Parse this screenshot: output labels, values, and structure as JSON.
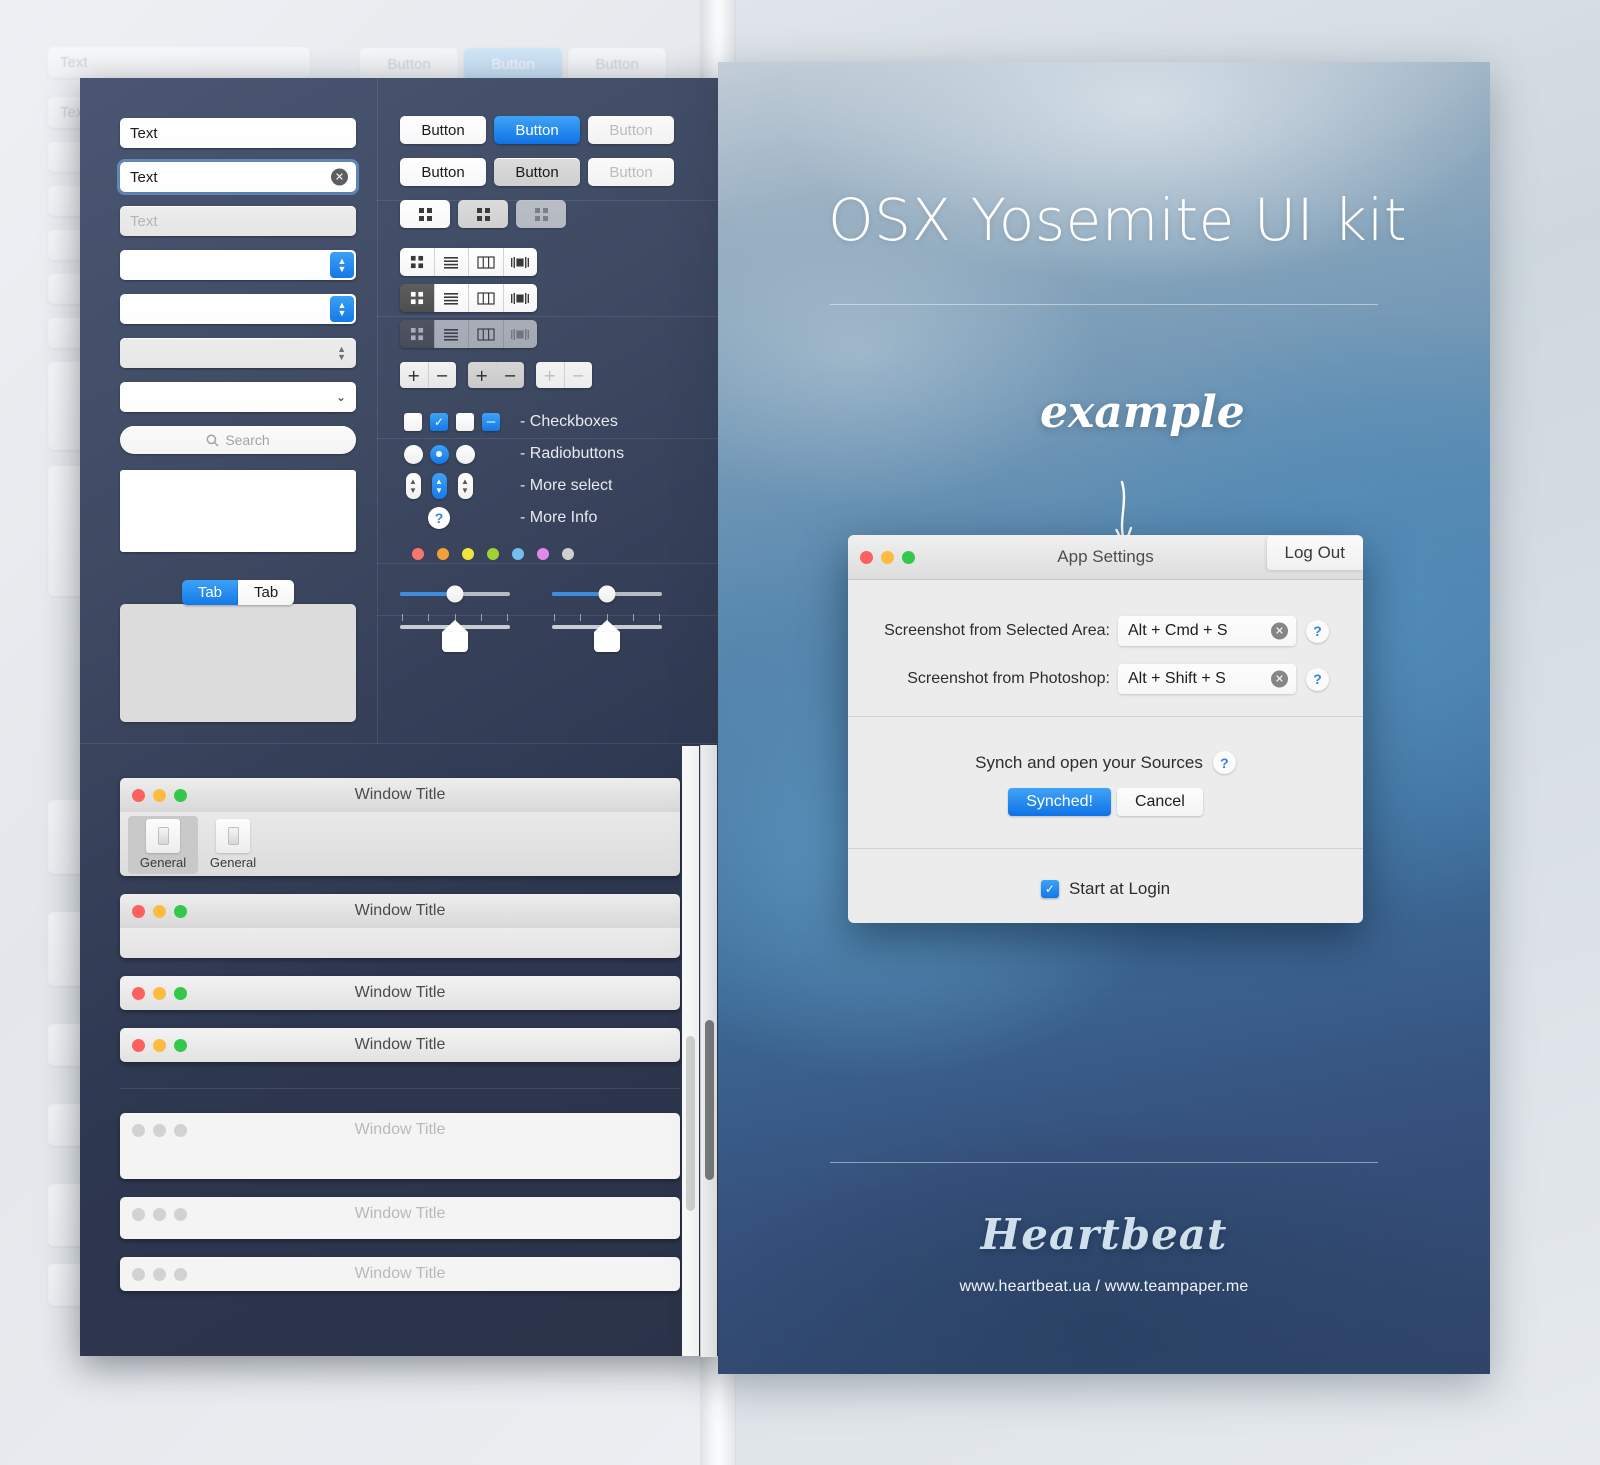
{
  "background": {
    "ghost_field_text": "Text",
    "ghost_buttons": [
      "Button",
      "Button",
      "Button"
    ]
  },
  "kit": {
    "fields": [
      {
        "name": "text-default",
        "value": "Text",
        "state": "default"
      },
      {
        "name": "text-focused",
        "value": "Text",
        "state": "focused",
        "clear_icon": "clear-circle-icon"
      },
      {
        "name": "text-disabled",
        "value": "Text",
        "state": "disabled"
      },
      {
        "name": "stepper-blue-1",
        "value": "",
        "state": "stepper-blue"
      },
      {
        "name": "stepper-blue-2",
        "value": "",
        "state": "stepper-blue"
      },
      {
        "name": "stepper-gray",
        "value": "",
        "state": "stepper-gray"
      },
      {
        "name": "dropdown",
        "value": "",
        "state": "dropdown"
      }
    ],
    "search": {
      "placeholder": "Search",
      "icon": "search-icon"
    },
    "tabs": [
      {
        "label": "Tab",
        "active": true
      },
      {
        "label": "Tab",
        "active": false
      }
    ],
    "button_rows": [
      [
        {
          "label": "Button",
          "style": "white"
        },
        {
          "label": "Button",
          "style": "blue"
        },
        {
          "label": "Button",
          "style": "dim"
        }
      ],
      [
        {
          "label": "Button",
          "style": "white"
        },
        {
          "label": "Button",
          "style": "gray"
        },
        {
          "label": "Button",
          "style": "dim"
        }
      ]
    ],
    "icon_buttons": [
      {
        "icon": "grid-view-icon",
        "style": "white"
      },
      {
        "icon": "grid-view-icon",
        "style": "gray"
      },
      {
        "icon": "grid-view-icon",
        "style": "dim"
      }
    ],
    "segmented_rows": [
      {
        "icons": [
          "grid-view-icon",
          "list-view-icon",
          "column-view-icon",
          "coverflow-view-icon"
        ],
        "selected": -1,
        "muted": false
      },
      {
        "icons": [
          "grid-view-icon",
          "list-view-icon",
          "column-view-icon",
          "coverflow-view-icon"
        ],
        "selected": 0,
        "muted": false
      },
      {
        "icons": [
          "grid-view-icon",
          "list-view-icon",
          "column-view-icon",
          "coverflow-view-icon"
        ],
        "selected": 0,
        "muted": true
      }
    ],
    "plus_minus": [
      {
        "plus": "+",
        "minus": "−",
        "style": "white"
      },
      {
        "plus": "+",
        "minus": "−",
        "style": "gray"
      },
      {
        "plus": "+",
        "minus": "−",
        "style": "dim"
      }
    ],
    "control_rows": [
      {
        "label": "- Checkboxes",
        "type": "checkbox"
      },
      {
        "label": "- Radiobuttons",
        "type": "radio"
      },
      {
        "label": "- More select",
        "type": "stepper"
      },
      {
        "label": "- More Info",
        "type": "info"
      }
    ],
    "dot_colors": [
      "#f9756e",
      "#f2a13a",
      "#f0e43c",
      "#9fd335",
      "#74bdf0",
      "#df8ae9",
      "#cfcfcf"
    ],
    "sliders": [
      {
        "name": "slider-fill-knob",
        "fill_percent": 50
      },
      {
        "name": "slider-fill-knob",
        "fill_percent": 50
      }
    ],
    "tick_sliders": [
      {
        "name": "slider-ticks-pin",
        "position_percent": 50,
        "ticks": 5
      },
      {
        "name": "slider-ticks-pin",
        "position_percent": 50,
        "ticks": 5
      }
    ],
    "windows": [
      {
        "title": "Window Title",
        "variant": "toolbar",
        "lights": "on",
        "toolbar_tabs": [
          {
            "label": "General",
            "icon": "preferences-general-icon",
            "selected": true
          },
          {
            "label": "General",
            "icon": "preferences-general-icon",
            "selected": false
          }
        ]
      },
      {
        "title": "Window Title",
        "variant": "tall",
        "lights": "on"
      },
      {
        "title": "Window Title",
        "variant": "short",
        "lights": "on"
      },
      {
        "title": "Window Title",
        "variant": "short",
        "lights": "on"
      },
      {
        "title": "Window Title",
        "variant": "tall-inactive",
        "lights": "off"
      },
      {
        "title": "Window Title",
        "variant": "short-inactive",
        "lights": "off"
      },
      {
        "title": "Window Title",
        "variant": "short-inactive",
        "lights": "off"
      }
    ],
    "window_light_colors": [
      "#fc615d",
      "#fdbc40",
      "#34c84a"
    ]
  },
  "poster": {
    "title": "OSX Yosemite UI kit",
    "example_label": "example",
    "arrow_icon": "down-arrow-icon",
    "brand": "Heartbeat",
    "brand_url": "www.heartbeat.ua / www.teampaper.me"
  },
  "dialog": {
    "title": "App Settings",
    "logout_label": "Log Out",
    "traffic_lights": [
      "#fc615d",
      "#fdbc40",
      "#34c84a"
    ],
    "shortcuts": [
      {
        "label": "Screenshot from Selected Area:",
        "value": "Alt + Cmd + S",
        "clear_icon": "clear-circle-icon",
        "help_icon": "help-icon",
        "help_label": "?"
      },
      {
        "label": "Screenshot from Photoshop:",
        "value": "Alt + Shift + S",
        "clear_icon": "clear-circle-icon",
        "help_icon": "help-icon",
        "help_label": "?"
      }
    ],
    "synch": {
      "text": "Synch and open your Sources",
      "help_label": "?",
      "primary_label": "Synched!",
      "cancel_label": "Cancel"
    },
    "start_at_login": {
      "label": "Start at Login",
      "checked": true,
      "check_glyph": "✓"
    }
  }
}
